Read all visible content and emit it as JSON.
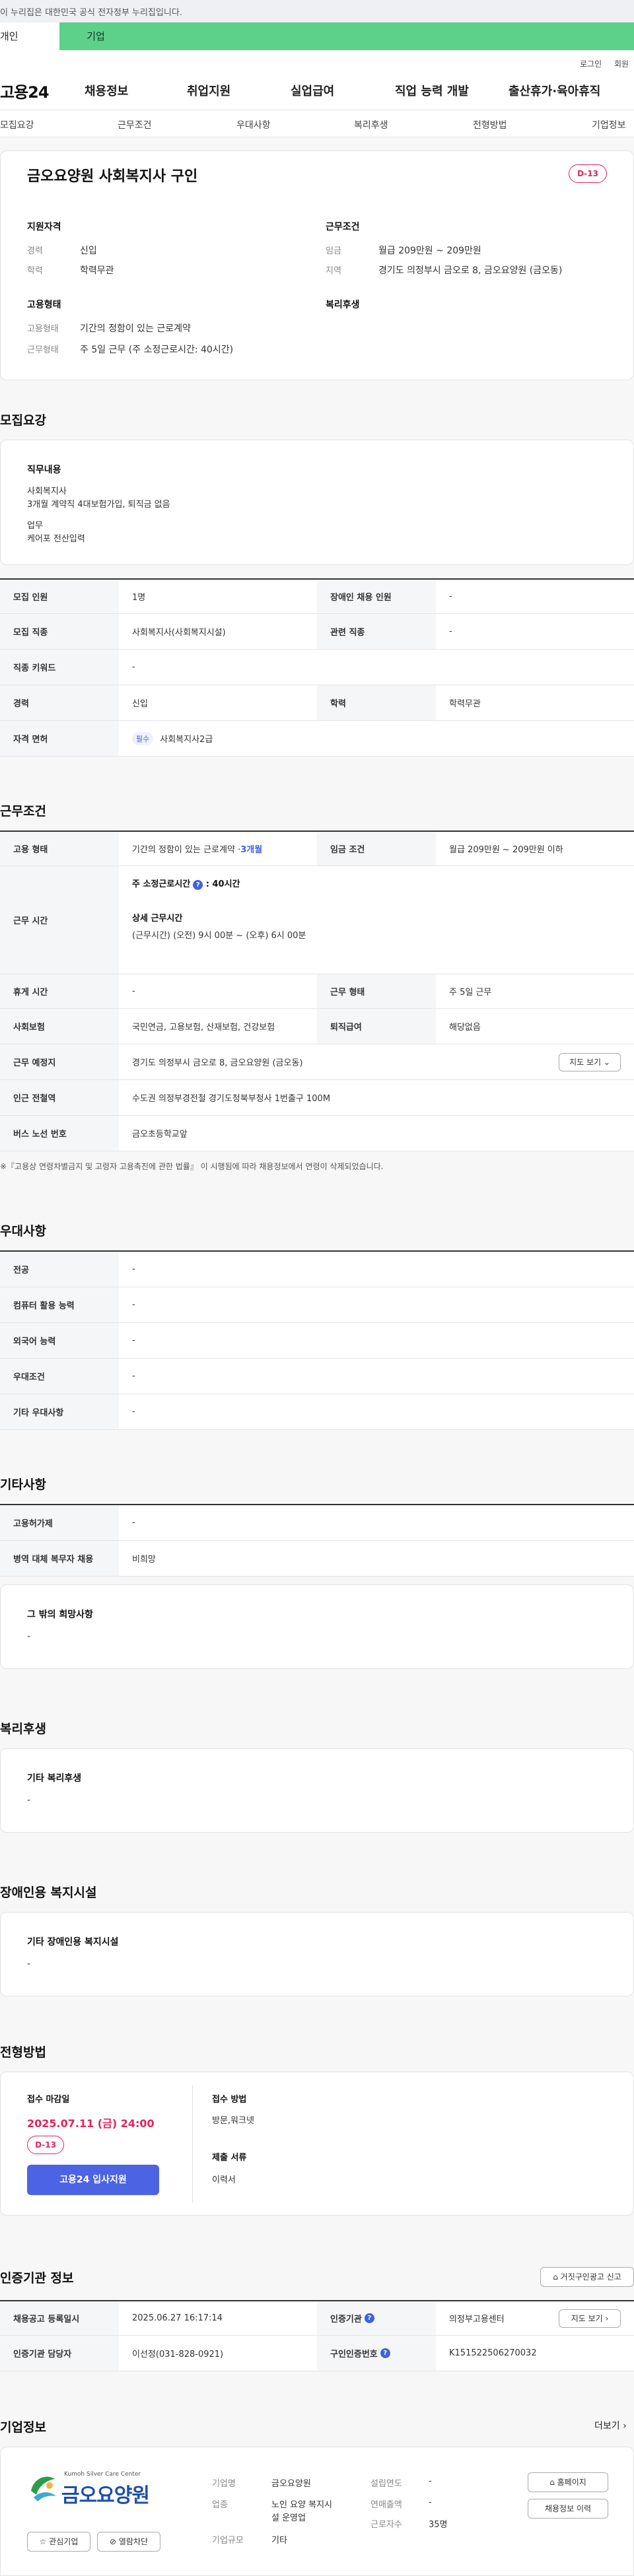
{
  "gov_banner": "이 누리집은 대한민국 공식 전자정부 누리집입니다.",
  "top_tabs": [
    "개인",
    "기업"
  ],
  "util": {
    "login": "로그인",
    "signup": "회원가입"
  },
  "gnb": {
    "logo": "고용24",
    "menu": [
      "채용정보",
      "취업지원",
      "실업급여",
      "직업 능력 개발",
      "출산휴가·육아휴직"
    ]
  },
  "anchor_tabs": [
    "모집요강",
    "근무조건",
    "우대사항",
    "복리후생",
    "전형방법",
    "기업정보"
  ],
  "summary": {
    "title": "금오요양원 사회복지사 구인",
    "dday": "D-13",
    "qual_title": "지원자격",
    "qual": [
      {
        "k": "경력",
        "v": "신입"
      },
      {
        "k": "학력",
        "v": "학력무관"
      }
    ],
    "cond_title": "근무조건",
    "cond": [
      {
        "k": "임금",
        "v": "월급 209만원 ~ 209만원"
      },
      {
        "k": "지역",
        "v": "경기도 의정부시 금오로 8, 금오요양원 (금오동)"
      }
    ],
    "emp_title": "고용형태",
    "emp": [
      {
        "k": "고용형태",
        "v": "기간의 정함이 있는 근로계약"
      },
      {
        "k": "근무형태",
        "v": "주 5일 근무 (주 소정근로시간: 40시간)"
      }
    ],
    "welfare_title": "복리후생"
  },
  "recruit": {
    "title": "모집요강",
    "duty_title": "직무내용",
    "duty_lines": [
      "사회복지사",
      "3개월 계약직 4대보험가입, 퇴직금 없음"
    ],
    "work_lines": [
      "업무",
      "케어포 전산입력"
    ],
    "rows": [
      {
        "k1": "모집 인원",
        "v1": "1명",
        "k2": "장애인 채용 인원",
        "v2": "-"
      },
      {
        "k1": "모집 직종",
        "v1": "사회복지사(사회복지시설)",
        "k2": "관련 직종",
        "v2": "-"
      },
      {
        "k1": "직종 키워드",
        "v1": "-"
      },
      {
        "k1": "경력",
        "v1": "신입",
        "k2": "학력",
        "v2": "학력무관"
      },
      {
        "k1": "자격 면허",
        "tag": "필수",
        "v1": "사회복지사2급"
      }
    ]
  },
  "work": {
    "title": "근무조건",
    "type_k": "고용 형태",
    "type_v": "기간의 정함이 있는 근로계약 · ",
    "type_period": "3개월",
    "wage_k": "임금 조건",
    "wage_v": "월급 209만원 ~ 209만원 이하",
    "hours_k": "근무 시간",
    "hours_weekly": "주 소정근로시간",
    "hours_weekly_val": ": 40시간",
    "hours_detail_t": "상세 근무시간",
    "hours_detail_v": "(근무시간) (오전) 9시 00분 ~ (오후) 6시 00분",
    "rest_k": "휴게 시간",
    "rest_v": "-",
    "form_k": "근무 형태",
    "form_v": "주 5일 근무",
    "ins_k": "사회보험",
    "ins_v": "국민연금, 고용보험, 산재보험, 건강보험",
    "sev_k": "퇴직급여",
    "sev_v": "해당없음",
    "loc_k": "근무 예정지",
    "loc_v": "경기도 의정부시 금오로 8, 금오요양원 (금오동)",
    "map_btn": "지도 보기",
    "sub_k": "인근 전철역",
    "sub_v": "수도권 의정부경전철 경기도청북부청사 1번출구 100M",
    "bus_k": "버스 노선 번호",
    "bus_v": "금오초등학교앞",
    "note": "※『고용상 연령차별금지 및 고령자 고용촉진에 관한 법률』 이 시행됨에 따라 채용정보에서 연령이 삭제되었습니다."
  },
  "pref": {
    "title": "우대사항",
    "rows": [
      {
        "k": "전공",
        "v": "-"
      },
      {
        "k": "컴퓨터 활용 능력",
        "v": "-"
      },
      {
        "k": "외국어 능력",
        "v": "-"
      },
      {
        "k": "우대조건",
        "v": "-"
      },
      {
        "k": "기타 우대사항",
        "v": "-"
      }
    ]
  },
  "etc": {
    "title": "기타사항",
    "rows": [
      {
        "k": "고용허가제",
        "v": "-"
      },
      {
        "k": "병역 대체 복무자 채용",
        "v": "비희망"
      }
    ],
    "box_title": "그 밖의 희망사항",
    "box_v": "-"
  },
  "welfare": {
    "title": "복리후생",
    "box_title": "기타 복리후생",
    "box_v": "-"
  },
  "disabled": {
    "title": "장애인용 복지시설",
    "box_title": "기타 장애인용 복지시설",
    "box_v": "-"
  },
  "selection": {
    "title": "전형방법",
    "deadline_t": "접수 마감일",
    "deadline_v": "2025.07.11 (금) 24:00",
    "dday": "D-13",
    "apply_btn": "고용24 입사지원",
    "method_t": "접수 방법",
    "method_v": "방문,워크넷",
    "docs_t": "제출 서류",
    "docs_v": "이력서"
  },
  "cert": {
    "title": "인증기관 정보",
    "report_btn": "거짓구인광고 신고",
    "reg_k": "채용공고 등록일시",
    "reg_v": "2025.06.27 16:17:14",
    "agency_k": "인증기관",
    "agency_v": "의정부고용센터",
    "map_btn": "지도 보기",
    "mgr_k": "인증기관 담당자",
    "mgr_v": "이선정(031-828-0921)",
    "no_k": "구인인증번호",
    "no_v": "K151522506270032"
  },
  "company": {
    "title": "기업정보",
    "more": "더보기",
    "logo_sub": "Kumoh Silver Care Center",
    "logo_main": "금오요양원",
    "fav_btn": "관심기업",
    "block_btn": "열람차단",
    "name_k": "기업명",
    "name_v": "금오요양원",
    "ind_k": "업종",
    "ind_v1": "노인 요양 복지시",
    "ind_v2": "설 운영업",
    "size_k": "기업규모",
    "size_v": "기타",
    "est_k": "설립연도",
    "est_v": "-",
    "sales_k": "연매출액",
    "sales_v": "-",
    "emp_k": "근로자수",
    "emp_v": "35명",
    "home_btn": "홈페이지",
    "jobs_btn": "채용정보 이력"
  },
  "colors": {
    "accent": "#4c63e3",
    "green": "#5dd08a",
    "dday": "#e0245e"
  }
}
